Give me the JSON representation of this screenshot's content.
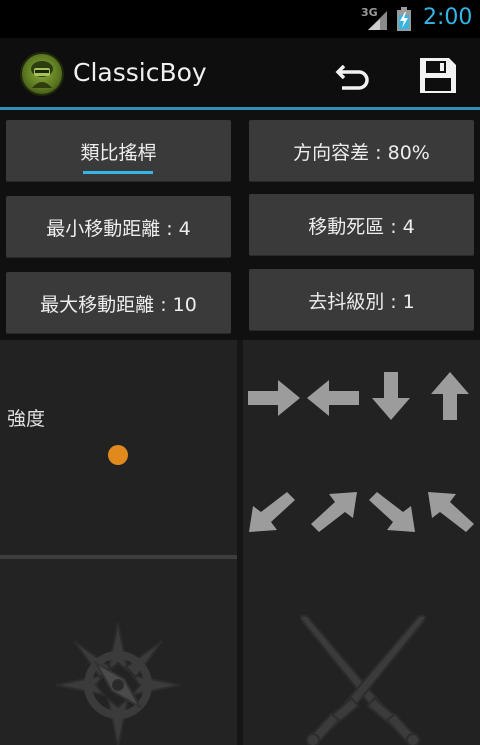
{
  "status_bar": {
    "network": "3G",
    "time": "2:00",
    "accent_color": "#33b5e5"
  },
  "action_bar": {
    "title": "ClassicBoy",
    "undo_icon": "undo-icon",
    "save_icon": "save-icon"
  },
  "settings": {
    "analog_stick": "類比搖桿",
    "direction_tolerance": "方向容差 : 80%",
    "min_move_distance": "最小移動距離 : 4",
    "move_dead_zone": "移動死區 : 4",
    "max_move_distance": "最大移動距離 : 10",
    "debounce_level": "去抖級別 : 1"
  },
  "strength_panel": {
    "label": "強度",
    "indicator_color": "#e08a1e"
  },
  "direction_arrows": [
    "arrow-right-icon",
    "arrow-left-icon",
    "arrow-down-icon",
    "arrow-up-icon",
    "arrow-down-left-icon",
    "arrow-up-right-icon",
    "arrow-down-right-icon",
    "arrow-up-left-icon"
  ],
  "bottom_icons": [
    "compass-icon",
    "crossed-swords-icon"
  ]
}
